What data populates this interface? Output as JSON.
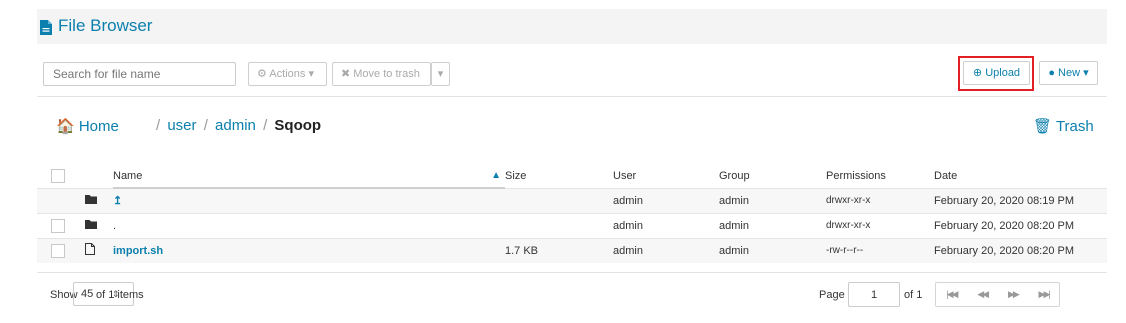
{
  "header": {
    "title": "File Browser",
    "icon": "file-icon"
  },
  "toolbar": {
    "search_placeholder": "Search for file name",
    "actions_label": "⚙ Actions ▾",
    "move_to_trash_label": "✖ Move to trash",
    "trash_caret": "▾",
    "upload_label": "⊕ Upload",
    "new_label": "● New ▾"
  },
  "breadcrumb": {
    "home_label": "🏠 Home",
    "sep": "/",
    "parts": [
      "user",
      "admin",
      "Sqoop"
    ]
  },
  "trash_link_label": "🗑 Trash",
  "table": {
    "columns": [
      "Name",
      "Size",
      "User",
      "Group",
      "Permissions",
      "Date"
    ],
    "sort_indicator": "▲",
    "rows": [
      {
        "icon": "folder-icon",
        "name": "↥",
        "size": "",
        "user": "admin",
        "group": "admin",
        "permissions": "drwxr-xr-x",
        "date": "February 20, 2020 08:19 PM"
      },
      {
        "icon": "folder-icon",
        "name": ".",
        "size": "",
        "user": "admin",
        "group": "admin",
        "permissions": "drwxr-xr-x",
        "date": "February 20, 2020 08:20 PM"
      },
      {
        "icon": "file-outline-icon",
        "name": "import.sh",
        "size": "1.7 KB",
        "user": "admin",
        "group": "admin",
        "permissions": "-rw-r--r--",
        "date": "February 20, 2020 08:20 PM"
      }
    ]
  },
  "footer": {
    "show_label": "Show",
    "page_size": "45",
    "of_items": "of 1 items",
    "page_label": "Page",
    "page_value": "1",
    "of_pages": "of 1",
    "pager": [
      "|◀◀",
      "◀◀",
      "▶▶",
      "▶▶|"
    ]
  },
  "colors": {
    "accent": "#0b7fad",
    "highlight": "#e31e24"
  }
}
